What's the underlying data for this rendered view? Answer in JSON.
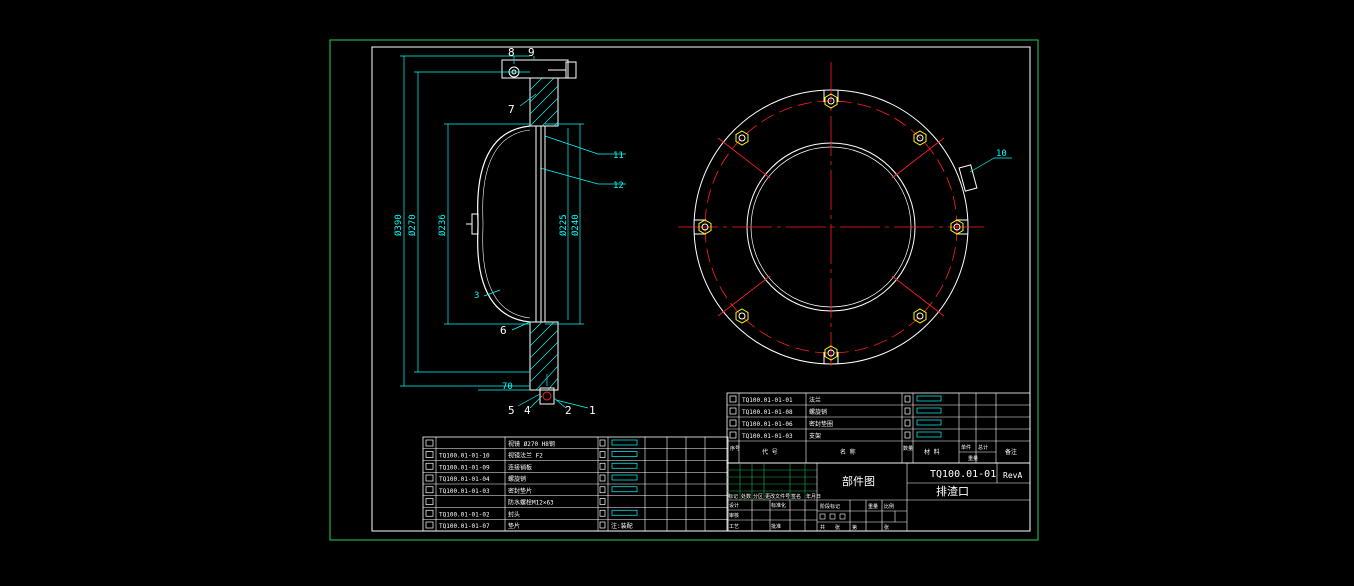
{
  "colors": {
    "background": "#000000",
    "sheet_border": "#22b14c",
    "frame": "#ffffff",
    "outline": "#ffffff",
    "dimension": "#00ffff",
    "centerline": "#ff2020",
    "hatch": "#00ffff",
    "bolt": "#ffff00",
    "table_green": "#22b14c"
  },
  "callouts": {
    "n8": "8",
    "n9": "9",
    "n7": "7",
    "n11": "11",
    "n12": "12",
    "n3": "3",
    "n6": "6",
    "n5": "5",
    "n4": "4",
    "n2": "2",
    "n1": "1",
    "n10": "10"
  },
  "dimensions": {
    "d390": "Ø390",
    "d270": "Ø270",
    "d236": "Ø236",
    "d225": "Ø225",
    "d240": "Ø240",
    "len70": "70"
  },
  "bom_left": {
    "rows": [
      {
        "code": "",
        "name": "视镜 Ø270 H8钢"
      },
      {
        "code": "TQ100.01-01-10",
        "name": "视镜法兰 F2"
      },
      {
        "code": "TQ100.01-01-09",
        "name": "连接销板"
      },
      {
        "code": "TQ100.01-01-04",
        "name": "螺旋销"
      },
      {
        "code": "TQ100.01-01-03",
        "name": "密封垫片"
      },
      {
        "code": "",
        "name": "防水螺栓M12×63"
      },
      {
        "code": "TQ100.01-01-02",
        "name": "封头"
      },
      {
        "code": "TQ100.01-01-07",
        "name": "垫片"
      }
    ],
    "last_note": "注:装配"
  },
  "bom_right": {
    "rows": [
      {
        "code": "TQ100.01-01-01",
        "name": "法兰"
      },
      {
        "code": "TQ100.01-01-08",
        "name": "螺旋销"
      },
      {
        "code": "TQ100.01-01-06",
        "name": "密封垫圈"
      },
      {
        "code": "TQ100.01-01-03",
        "name": "支架"
      }
    ],
    "header": {
      "seq": "序号",
      "code": "代 号",
      "name": "名 称",
      "qty": "数量",
      "material": "材 料",
      "unit_wt": "单件",
      "total_wt": "总计",
      "weight": "重量",
      "remark": "备注"
    }
  },
  "title_block": {
    "drawing_type": "部件图",
    "drawing_no": "TQ100.01-01",
    "revision": "RevA",
    "part_name": "排渣口",
    "small_labels": [
      "标记",
      "处数",
      "分区",
      "更改文件号",
      "签名",
      "年月日"
    ],
    "roles": [
      "设计",
      "标准化",
      "审核",
      "工艺",
      "批准"
    ],
    "stage_labels": [
      "阶段标记",
      "重量",
      "比例"
    ],
    "sheet_labels": [
      "共",
      "张",
      "第",
      "张"
    ]
  }
}
